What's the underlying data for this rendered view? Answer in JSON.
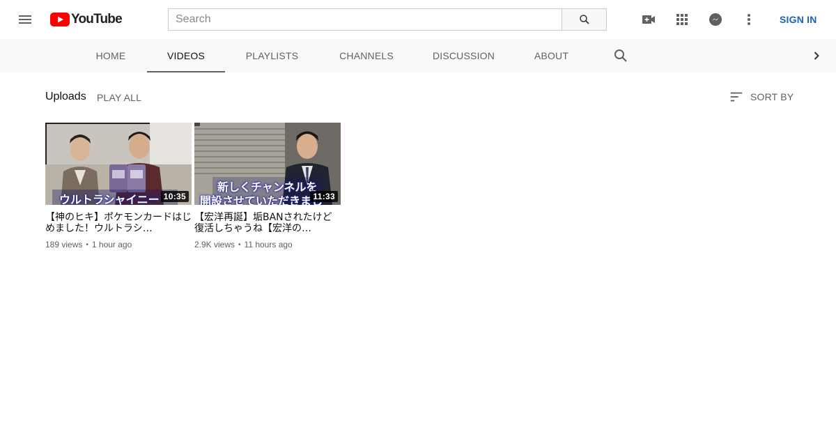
{
  "masthead": {
    "logo_text": "YouTube",
    "search_placeholder": "Search",
    "sign_in_label": "SIGN IN",
    "icons": [
      "menu-icon",
      "youtube-logo-icon",
      "search-icon",
      "create-video-icon",
      "apps-grid-icon",
      "messages-icon",
      "more-vert-icon"
    ]
  },
  "tabs": [
    {
      "label": "HOME",
      "active": false
    },
    {
      "label": "VIDEOS",
      "active": true
    },
    {
      "label": "PLAYLISTS",
      "active": false
    },
    {
      "label": "CHANNELS",
      "active": false
    },
    {
      "label": "DISCUSSION",
      "active": false
    },
    {
      "label": "ABOUT",
      "active": false
    }
  ],
  "uploads": {
    "title": "Uploads",
    "play_all_label": "PLAY ALL",
    "sort_label": "SORT BY"
  },
  "videos": [
    {
      "title": "【神のヒキ】ポケモンカードはじめました！ウルトラシ…",
      "duration": "10:35",
      "views": "189 views",
      "age": "1 hour ago",
      "thumb_caption": "ウルトラシャイニー"
    },
    {
      "title": "【宏洋再誕】垢BANされたけど復活しちゃうね【宏洋の…",
      "duration": "11:33",
      "views": "2.9K views",
      "age": "11 hours ago",
      "thumb_caption_line1": "新しくチャンネルを",
      "thumb_caption_line2": "開設させていただきまし"
    }
  ],
  "colors": {
    "brand_red": "#ff0000",
    "link_blue": "#1c62b9",
    "tab_bar_bg": "#f9f9f9",
    "secondary_text": "#606060"
  }
}
